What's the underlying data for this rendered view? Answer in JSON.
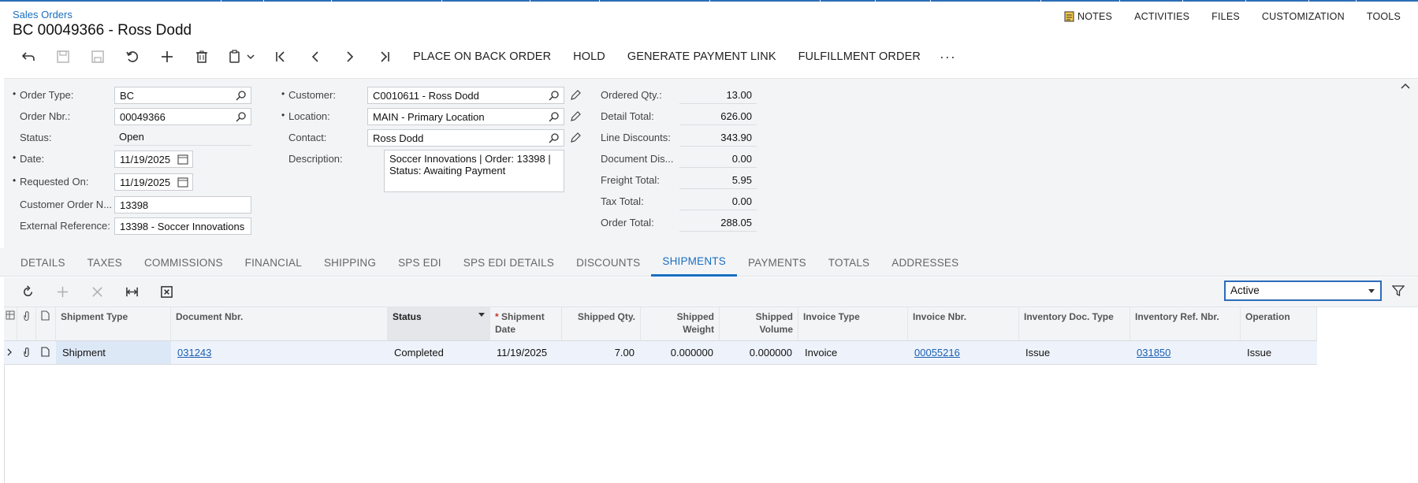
{
  "breadcrumb": "Sales Orders",
  "title": "BC 00049366 - Ross Dodd",
  "topmenu": {
    "notes": "NOTES",
    "activities": "ACTIVITIES",
    "files": "FILES",
    "customization": "CUSTOMIZATION",
    "tools": "TOOLS"
  },
  "toolbar": {
    "place_on_back_order": "PLACE ON BACK ORDER",
    "hold": "HOLD",
    "generate_payment_link": "GENERATE PAYMENT LINK",
    "fulfillment_order": "FULFILLMENT ORDER",
    "more": "···"
  },
  "form": {
    "order_type_label": "Order Type:",
    "order_type": "BC",
    "order_nbr_label": "Order Nbr.:",
    "order_nbr": "00049366",
    "status_label": "Status:",
    "status": "Open",
    "date_label": "Date:",
    "date": "11/19/2025",
    "requested_on_label": "Requested On:",
    "requested_on": "11/19/2025",
    "customer_order_label": "Customer Order N...",
    "customer_order": "13398",
    "external_ref_label": "External Reference:",
    "external_ref": "13398 - Soccer Innovations",
    "customer_label": "Customer:",
    "customer": "C0010611 - Ross Dodd",
    "location_label": "Location:",
    "location": "MAIN - Primary Location",
    "contact_label": "Contact:",
    "contact": "Ross Dodd",
    "description_label": "Description:",
    "description": "Soccer Innovations | Order: 13398 | Status: Awaiting Payment",
    "ordered_qty_label": "Ordered Qty.:",
    "ordered_qty": "13.00",
    "detail_total_label": "Detail Total:",
    "detail_total": "626.00",
    "line_discounts_label": "Line Discounts:",
    "line_discounts": "343.90",
    "document_dis_label": "Document Dis...",
    "document_dis": "0.00",
    "freight_total_label": "Freight Total:",
    "freight_total": "5.95",
    "tax_total_label": "Tax Total:",
    "tax_total": "0.00",
    "order_total_label": "Order Total:",
    "order_total": "288.05"
  },
  "tabs": [
    "DETAILS",
    "TAXES",
    "COMMISSIONS",
    "FINANCIAL",
    "SHIPPING",
    "SPS EDI",
    "SPS EDI DETAILS",
    "DISCOUNTS",
    "SHIPMENTS",
    "PAYMENTS",
    "TOTALS",
    "ADDRESSES"
  ],
  "active_tab": "SHIPMENTS",
  "filter": {
    "value": "Active"
  },
  "grid": {
    "headers": {
      "shipment_type": "Shipment Type",
      "document_nbr": "Document Nbr.",
      "status": "Status",
      "shipment_date_1": "Shipment",
      "shipment_date_2": "Date",
      "shipped_qty": "Shipped Qty.",
      "shipped_weight_1": "Shipped",
      "shipped_weight_2": "Weight",
      "shipped_volume_1": "Shipped",
      "shipped_volume_2": "Volume",
      "invoice_type": "Invoice Type",
      "invoice_nbr": "Invoice Nbr.",
      "inventory_doc_type": "Inventory Doc. Type",
      "inventory_ref_nbr": "Inventory Ref. Nbr.",
      "operation": "Operation"
    },
    "row": {
      "shipment_type": "Shipment",
      "document_nbr": "031243",
      "status": "Completed",
      "shipment_date": "11/19/2025",
      "shipped_qty": "7.00",
      "shipped_weight": "0.000000",
      "shipped_volume": "0.000000",
      "invoice_type": "Invoice",
      "invoice_nbr": "00055216",
      "inventory_doc_type": "Issue",
      "inventory_ref_nbr": "031850",
      "operation": "Issue"
    }
  }
}
